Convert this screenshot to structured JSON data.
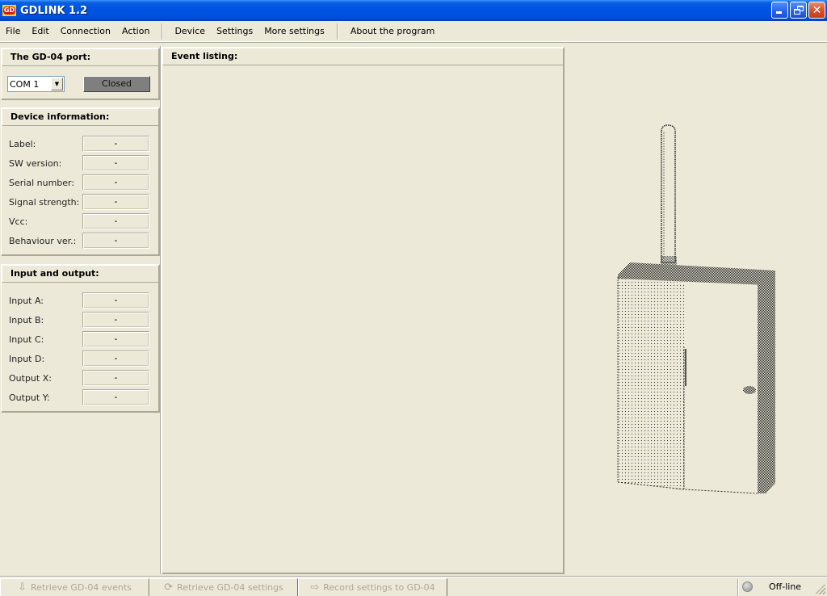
{
  "window": {
    "logo_text": "GD",
    "title": "GDLINK 1.2",
    "buttons": [
      "minimize",
      "restore",
      "close"
    ]
  },
  "menu": {
    "items": [
      {
        "label": "File"
      },
      {
        "label": "Edit"
      },
      {
        "label": "Connection"
      },
      {
        "label": "Action"
      },
      {
        "label": "Device"
      },
      {
        "label": "Settings"
      },
      {
        "label": "More settings"
      },
      {
        "label": "About the program"
      }
    ]
  },
  "port_panel": {
    "title": "The GD-04 port:",
    "port_select": {
      "selected": "COM 1"
    },
    "status_button": "Closed"
  },
  "device_info": {
    "title": "Device information:",
    "fields": [
      {
        "label": "Label:",
        "value": "-"
      },
      {
        "label": "SW version:",
        "value": "-"
      },
      {
        "label": "Serial number:",
        "value": "-"
      },
      {
        "label": "Signal strength:",
        "value": "-"
      },
      {
        "label": "Vcc:",
        "value": "-"
      },
      {
        "label": "Behaviour ver.:",
        "value": "-"
      }
    ]
  },
  "io": {
    "title": "Input and output:",
    "fields": [
      {
        "label": "Input A:",
        "value": "-"
      },
      {
        "label": "Input B:",
        "value": "-"
      },
      {
        "label": "Input C:",
        "value": "-"
      },
      {
        "label": "Input D:",
        "value": "-"
      },
      {
        "label": "Output X:",
        "value": "-"
      },
      {
        "label": "Output Y:",
        "value": "-"
      }
    ]
  },
  "events": {
    "title": "Event listing:",
    "items": []
  },
  "toolbar": {
    "retrieve_events": {
      "label": "Retrieve GD-04 events",
      "icon": "download-icon",
      "enabled": false
    },
    "retrieve_settings": {
      "label": "Retrieve GD-04 settings",
      "icon": "refresh-icon",
      "enabled": false
    },
    "record_settings": {
      "label": "Record settings to GD-04",
      "icon": "arrow-right-icon",
      "enabled": false
    }
  },
  "status": {
    "connection": "Off-line",
    "led_color": "#b0b0b0"
  }
}
